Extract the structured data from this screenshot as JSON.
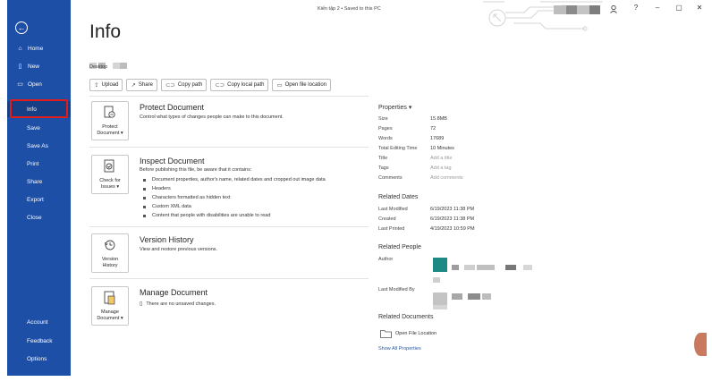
{
  "titlebar": {
    "document": "Kiến tập 2 • Saved to this PC",
    "help_glyph": "?",
    "minimize_glyph": "–",
    "maximize_glyph": "▢",
    "close_glyph": "✕"
  },
  "nav": {
    "back_glyph": "←",
    "top_items": [
      {
        "label": "Home",
        "icon": "⌂"
      },
      {
        "label": "New",
        "icon": "▯"
      },
      {
        "label": "Open",
        "icon": "▭"
      }
    ],
    "sub_items": [
      {
        "label": "Info",
        "selected": true
      },
      {
        "label": "Save"
      },
      {
        "label": "Save As"
      },
      {
        "label": "Print"
      },
      {
        "label": "Share"
      },
      {
        "label": "Export"
      },
      {
        "label": "Close"
      }
    ],
    "bottom_items": [
      {
        "label": "Account"
      },
      {
        "label": "Feedback"
      },
      {
        "label": "Options"
      }
    ],
    "highlight_color": "#e21b1b",
    "background_color": "#1e4fa6"
  },
  "main": {
    "title": "Info",
    "location_label": "Desktop",
    "actions": [
      {
        "label": "Upload",
        "icon": "upload-icon"
      },
      {
        "label": "Share",
        "icon": "share-icon"
      },
      {
        "label": "Copy path",
        "icon": "link-icon"
      },
      {
        "label": "Copy local path",
        "icon": "link-icon"
      },
      {
        "label": "Open file location",
        "icon": "folder-icon"
      }
    ],
    "protect": {
      "tile_line1": "Protect",
      "tile_line2": "Document ▾",
      "title": "Protect Document",
      "desc": "Control what types of changes people can make to this document."
    },
    "inspect": {
      "tile_line1": "Check for",
      "tile_line2": "Issues ▾",
      "title": "Inspect Document",
      "desc": "Before publishing this file, be aware that it contains:",
      "items": [
        "Document properties, author's name, related dates and cropped out image data",
        "Headers",
        "Characters formatted as hidden text",
        "Custom XML data",
        "Content that people with disabilities are unable to read"
      ]
    },
    "version": {
      "tile_line1": "Version",
      "tile_line2": "History",
      "title": "Version History",
      "desc": "View and restore previous versions."
    },
    "manage": {
      "tile_line1": "Manage",
      "tile_line2": "Document ▾",
      "title": "Manage Document",
      "desc": "There are no unsaved changes."
    }
  },
  "properties": {
    "header": "Properties ▾",
    "rows": [
      {
        "key": "Size",
        "value": "15.8MB"
      },
      {
        "key": "Pages",
        "value": "72"
      },
      {
        "key": "Words",
        "value": "17689"
      },
      {
        "key": "Total Editing Time",
        "value": "10 Minutes"
      },
      {
        "key": "Title",
        "value": "Add a title",
        "placeholder": true
      },
      {
        "key": "Tags",
        "value": "Add a tag",
        "placeholder": true
      },
      {
        "key": "Comments",
        "value": "Add comments",
        "placeholder": true
      }
    ],
    "related_dates_header": "Related Dates",
    "dates": [
      {
        "key": "Last Modified",
        "value": "6/19/2023 11:38 PM"
      },
      {
        "key": "Created",
        "value": "6/19/2023 11:38 PM"
      },
      {
        "key": "Last Printed",
        "value": "4/19/2023 10:59 PM"
      }
    ],
    "related_people_header": "Related People",
    "author_label": "Author",
    "last_modified_by_label": "Last Modified By",
    "related_documents_header": "Related Documents",
    "open_file_location": "Open File Location",
    "show_all": "Show All Properties"
  }
}
